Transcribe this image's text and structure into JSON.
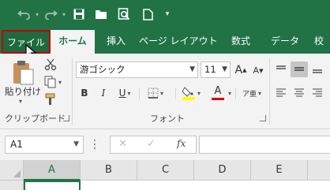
{
  "colors": {
    "accent": "#217346",
    "file_tab_highlight": "#c00000",
    "font_color_swatch": "#e00000",
    "fill_color_swatch": "#ffff00"
  },
  "quick_access": {
    "undo": "undo-icon",
    "redo": "redo-icon",
    "save": "save-icon",
    "open": "open-folder-icon",
    "print_preview": "print-preview-icon",
    "new": "new-document-icon",
    "customize": "customize-qat-icon"
  },
  "tabs": [
    "ファイル",
    "ホーム",
    "挿入",
    "ページ レイアウト",
    "数式",
    "データ",
    "校"
  ],
  "ribbon": {
    "clipboard": {
      "paste_label": "貼り付け",
      "group_label": "クリップボード"
    },
    "font": {
      "font_name": "游ゴシック",
      "font_size": "11",
      "grow": "A",
      "shrink": "A",
      "bold": "B",
      "italic": "I",
      "underline": "U",
      "font_color_letter": "A",
      "phonetic_label": "ア亜",
      "group_label": "フォント"
    }
  },
  "formula_bar": {
    "name_box": "A1",
    "cancel": "✕",
    "enter": "✓",
    "fx": "fx"
  },
  "grid": {
    "columns": [
      "A",
      "B",
      "C",
      "D",
      "E"
    ]
  }
}
